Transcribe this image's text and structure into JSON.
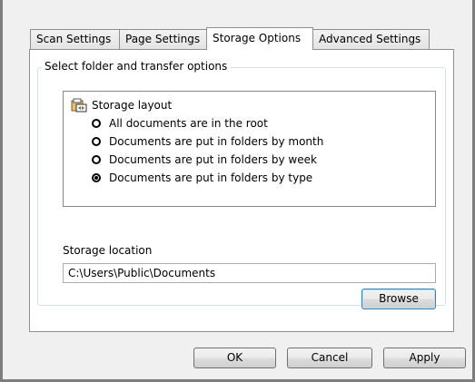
{
  "tabs": [
    "Scan Settings",
    "Page Settings",
    "Storage Options",
    "Advanced Settings"
  ],
  "active_tab": "Storage Options",
  "group": {
    "title": "Select folder and transfer options"
  },
  "tree": {
    "root_label": "Storage layout",
    "root_icon": "storage-layout-icon",
    "options": [
      {
        "label": "All documents are in the root",
        "checked": false
      },
      {
        "label": "Documents are put in folders by month",
        "checked": false
      },
      {
        "label": "Documents are put in folders by week",
        "checked": false
      },
      {
        "label": "Documents are put in folders by type",
        "checked": true
      }
    ]
  },
  "storage": {
    "label": "Storage location",
    "value": "C:\\Users\\Public\\Documents",
    "browse_label": "Browse"
  },
  "buttons": {
    "ok": "OK",
    "cancel": "Cancel",
    "apply": "Apply"
  }
}
